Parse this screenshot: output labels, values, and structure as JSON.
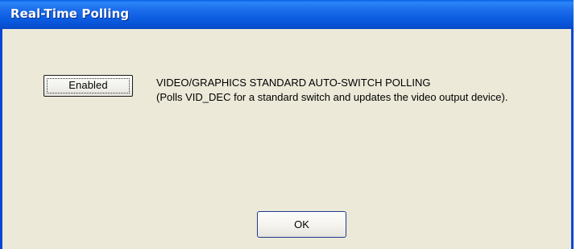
{
  "window": {
    "title": "Real-Time Polling",
    "accent_color": "#0a5ee6",
    "face_color": "#ece9d8"
  },
  "content": {
    "toggle_button_label": "Enabled",
    "heading": "VIDEO/GRAPHICS STANDARD AUTO-SWITCH POLLING",
    "description": "(Polls VID_DEC for a standard switch and updates the video output device)."
  },
  "footer": {
    "ok_label": "OK"
  }
}
